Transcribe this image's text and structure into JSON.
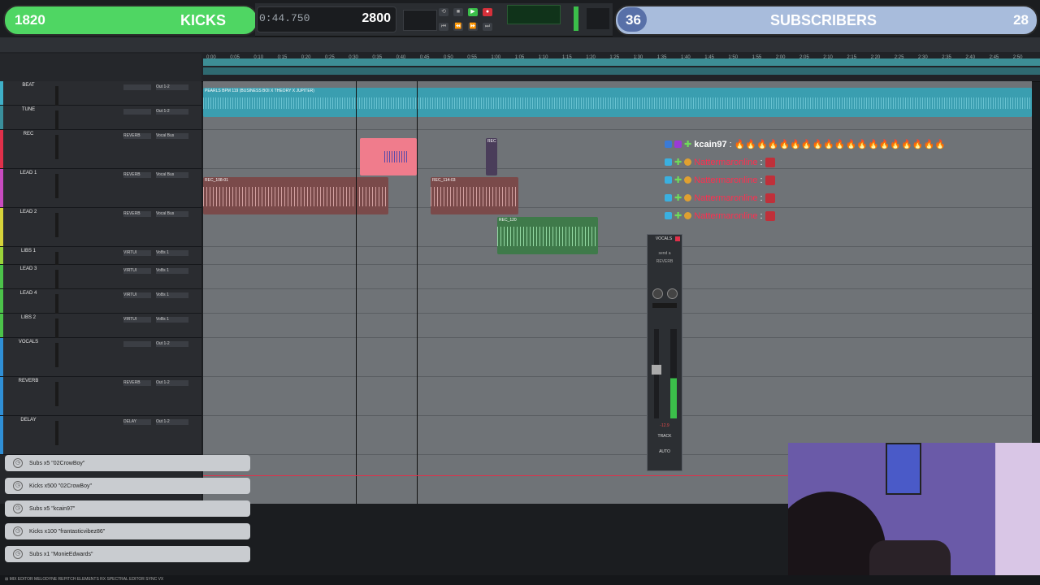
{
  "overlay": {
    "kicks_goal": {
      "current": "1820",
      "label": "KICKS",
      "target": "2800"
    },
    "subs_goal": {
      "current": "36",
      "label": "SUBSCRIBERS",
      "target": "28"
    }
  },
  "transport": {
    "time": "0:44.750",
    "bpm": "2800"
  },
  "ruler_ticks": [
    "0:00",
    "0:05",
    "0:10",
    "0:15",
    "0:20",
    "0:25",
    "0:30",
    "0:35",
    "0:40",
    "0:45",
    "0:50",
    "0:55",
    "1:00",
    "1:05",
    "1:10",
    "1:15",
    "1:20",
    "1:25",
    "1:30",
    "1:35",
    "1:40",
    "1:45",
    "1:50",
    "1:55",
    "2:00",
    "2:05",
    "2:10",
    "2:15",
    "2:20",
    "2:25",
    "2:30",
    "2:35",
    "2:40",
    "2:45",
    "2:50"
  ],
  "tracks": [
    {
      "name": "BEAT",
      "color": "#3fb0c8",
      "insert": "",
      "io": "Out 1-2"
    },
    {
      "name": "TUNE",
      "color": "#3a8f9c",
      "insert": "",
      "io": "Out 1-2"
    },
    {
      "name": "REC",
      "color": "#e0304a",
      "insert": "REVERB",
      "io": "Vocal Bus"
    },
    {
      "name": "LEAD 1",
      "color": "#c74bbf",
      "insert": "REVERB",
      "io": "Vocal Bus"
    },
    {
      "name": "LEAD 2",
      "color": "#d6d33a",
      "insert": "REVERB",
      "io": "Vocal Bus"
    },
    {
      "name": "LIBS 1",
      "color": "#9bd33a",
      "insert": "VIRTUI",
      "io": "VoBs 1"
    },
    {
      "name": "LEAD 3",
      "color": "#4cc34a",
      "insert": "VIRTUI",
      "io": "VoBs 1"
    },
    {
      "name": "LEAD 4",
      "color": "#4cc34a",
      "insert": "VIRTUI",
      "io": "VoBs 1"
    },
    {
      "name": "LIBS 2",
      "color": "#4cc34a",
      "insert": "VIRTUI",
      "io": "VoBs 1"
    },
    {
      "name": "VOCALS",
      "color": "#2f8fd6",
      "insert": "",
      "io": "Out 1-2"
    },
    {
      "name": "REVERB",
      "color": "#2f8fd6",
      "insert": "REVERB",
      "io": "Out 1-2"
    },
    {
      "name": "DELAY",
      "color": "#2f8fd6",
      "insert": "DELAY",
      "io": "Out 1-2"
    }
  ],
  "clips": [
    {
      "name": "PEARLS BPM 119 (BUSINESS BOI X THEORY X JUPITER)",
      "color": "#3a9eb0"
    },
    {
      "name": "",
      "color": "#f07c8c"
    },
    {
      "name": "REC",
      "color": "#4a3d5a"
    },
    {
      "name": "REC_108-01",
      "color": "#7a4a4a"
    },
    {
      "name": "REC_114-03",
      "color": "#7a4a4a"
    },
    {
      "name": "REC_120",
      "color": "#3f7a4a"
    }
  ],
  "chat": [
    {
      "user": "kcain97",
      "msg": "🔥🔥🔥🔥🔥🔥🔥🔥🔥🔥🔥🔥🔥🔥🔥🔥🔥🔥🔥"
    },
    {
      "user": "Nattermaronline",
      "msg": ""
    },
    {
      "user": "Nattermaronline",
      "msg": ""
    },
    {
      "user": "Nattermaronline",
      "msg": ""
    },
    {
      "user": "Nattermaronline",
      "msg": ""
    }
  ],
  "plugin": {
    "title": "VOCALS",
    "send": "send a",
    "dest": "REVERB",
    "vol": "-12.9",
    "label": "TRACK",
    "mode": "AUTO"
  },
  "alerts": [
    {
      "text": "Subs x5 \"02CrowBoy\""
    },
    {
      "text": "Kicks x500 \"02CrowBoy\""
    },
    {
      "text": "Subs x5 \"kcain97\""
    },
    {
      "text": "Kicks x100 \"frantasticvibez86\""
    },
    {
      "text": "Subs x1 \"MonieEdwards\""
    }
  ],
  "bottom_bar": {
    "text": "⊞ MIX EDITOR    MELODYNE    REPITCH ELEMENTS    RX SPECTRAL EDITOR    SYNC VX"
  },
  "colors": {
    "kicks_bar": "#4fd663",
    "subs_bar": "#a8bcdc",
    "edit_bg": "#6f7377"
  }
}
